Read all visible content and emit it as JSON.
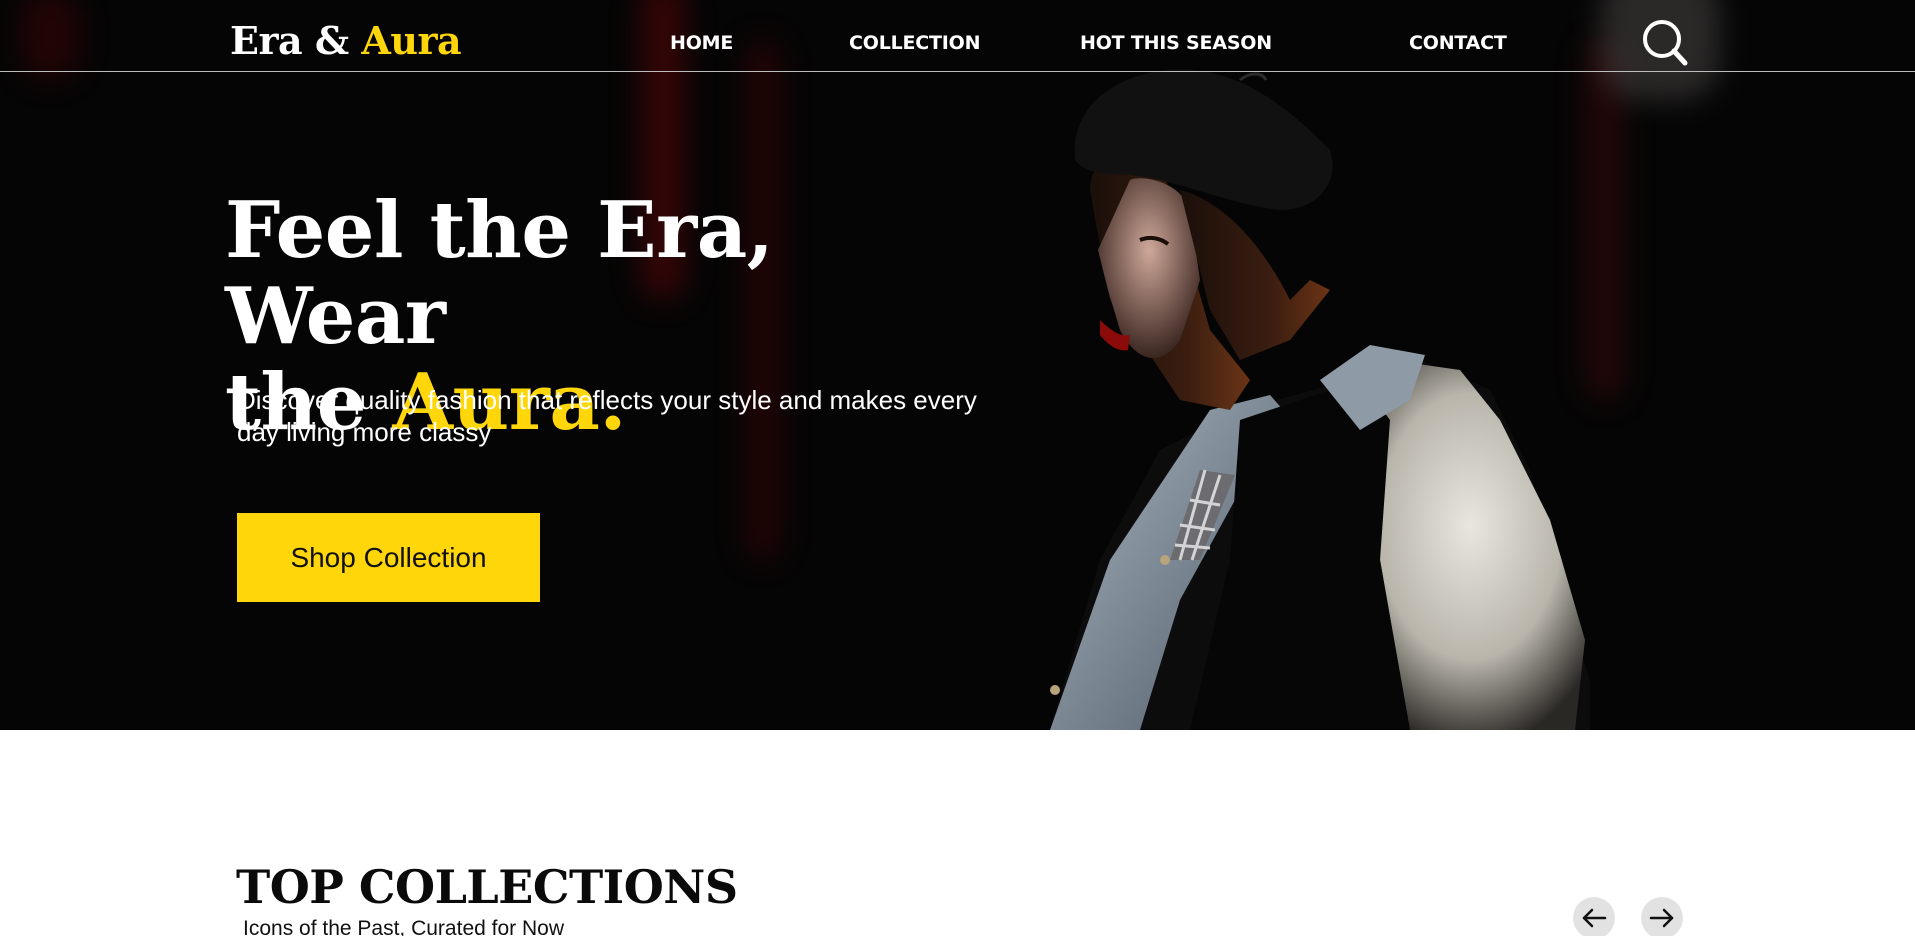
{
  "brand": {
    "name_part1": "Era &",
    "name_part2": "Aura",
    "accent_color": "#ffd60a"
  },
  "nav": {
    "items": [
      {
        "label": "HOME"
      },
      {
        "label": "COLLECTION"
      },
      {
        "label": "HOT THIS SEASON"
      },
      {
        "label": "CONTACT"
      }
    ],
    "search_icon": "search-icon"
  },
  "hero": {
    "headline_line1": "Feel the Era, Wear",
    "headline_line2_prefix": "the",
    "headline_line2_accent": "Aura.",
    "subtext": "Discover quality fashion that reflects your style and makes every day living more classy",
    "cta_label": "Shop Collection",
    "background_color": "#050505"
  },
  "collections": {
    "title": "TOP COLLECTIONS",
    "subtitle": "Icons of the Past, Curated for Now",
    "prev_icon": "arrow-left-icon",
    "next_icon": "arrow-right-icon"
  }
}
